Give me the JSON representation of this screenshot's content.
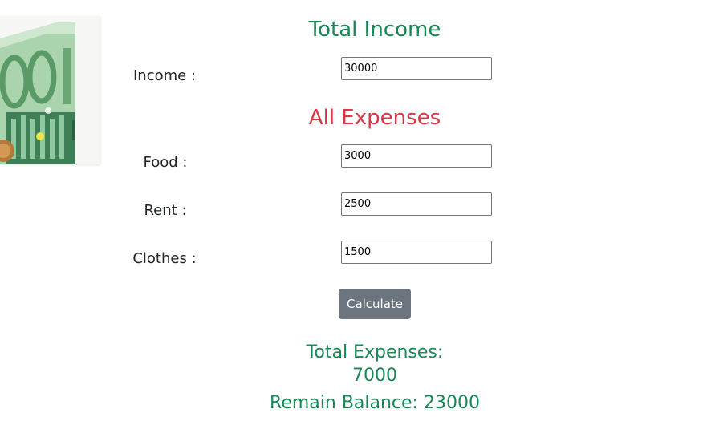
{
  "image": {
    "alt": "euro banknote photo"
  },
  "income_section": {
    "heading": "Total Income",
    "income_label": "Income :",
    "income_value": "30000"
  },
  "expenses_section": {
    "heading": "All Expenses",
    "food_label": "Food :",
    "food_value": "3000",
    "rent_label": "Rent :",
    "rent_value": "2500",
    "clothes_label": "Clothes :",
    "clothes_value": "1500"
  },
  "calculate_label": "Calculate",
  "results": {
    "total_expenses_label": "Total Expenses:",
    "total_expenses_value": "7000",
    "remain_balance_label": "Remain Balance:",
    "remain_balance_value": "23000"
  },
  "colors": {
    "success": "#198754",
    "danger": "#dc3545",
    "button": "#6c757d"
  }
}
